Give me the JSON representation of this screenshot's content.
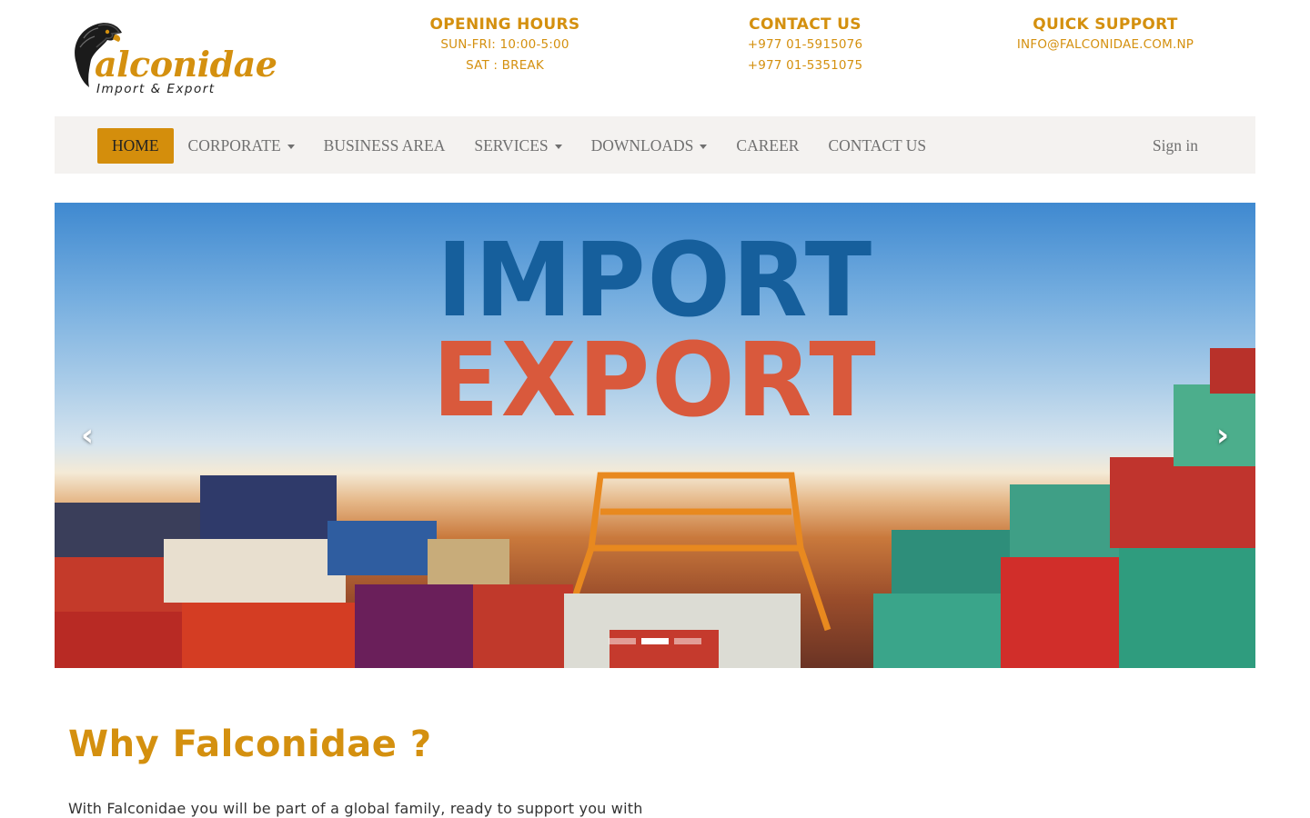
{
  "logo": {
    "text": "alconidae",
    "subtext": "Import & Export"
  },
  "header": {
    "blocks": [
      {
        "title": "OPENING HOURS",
        "lines": [
          "SUN-FRI: 10:00-5:00",
          "SAT : BREAK"
        ]
      },
      {
        "title": "CONTACT US",
        "lines": [
          "+977 01-5915076",
          "+977 01-5351075"
        ]
      },
      {
        "title": "QUICK SUPPORT",
        "lines": [
          "INFO@FALCONIDAE.COM.NP"
        ]
      }
    ]
  },
  "nav": {
    "items": [
      {
        "label": "HOME",
        "active": true,
        "dropdown": false
      },
      {
        "label": "CORPORATE",
        "active": false,
        "dropdown": true
      },
      {
        "label": "BUSINESS AREA",
        "active": false,
        "dropdown": false
      },
      {
        "label": "SERVICES",
        "active": false,
        "dropdown": true
      },
      {
        "label": "DOWNLOADS",
        "active": false,
        "dropdown": true
      },
      {
        "label": "CAREER",
        "active": false,
        "dropdown": false
      },
      {
        "label": "CONTACT US",
        "active": false,
        "dropdown": false
      }
    ],
    "signin_label": "Sign in"
  },
  "carousel": {
    "headline_line1": "IMPORT",
    "headline_line2": "EXPORT",
    "prev_icon": "‹",
    "next_icon": "›",
    "slide_count": 3,
    "active_index": 1
  },
  "why": {
    "title": "Why Falconidae ?",
    "text": "With Falconidae you will be part of a global family, ready to support you with"
  },
  "colors": {
    "accent": "#d4900f",
    "nav_bg": "#f4f2f0",
    "nav_active_bg": "#d48e0c",
    "headline_blue": "#165f9c",
    "headline_red": "#d9593c"
  }
}
